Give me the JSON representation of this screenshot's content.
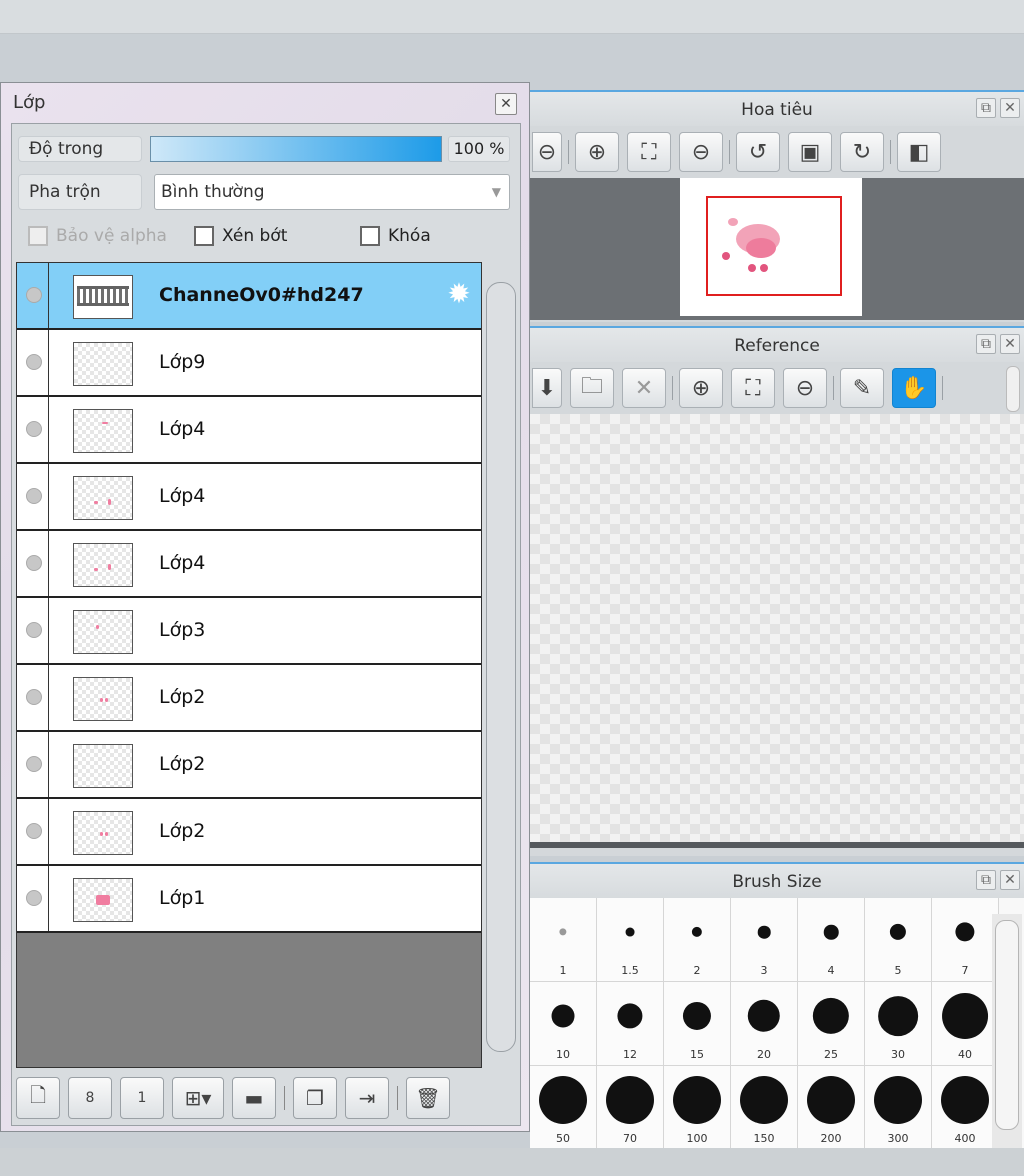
{
  "navigator": {
    "title": "Hoa tiêu",
    "tools": [
      "zoom-actual-icon",
      "zoom-in-icon",
      "fit-icon",
      "zoom-out-icon",
      "rotate-left-icon",
      "frame-icon",
      "rotate-right-icon",
      "flip-icon"
    ],
    "view_rect_color": "#e01f1f"
  },
  "reference": {
    "title": "Reference",
    "tools": [
      "import-icon",
      "open-folder-icon",
      "close-icon",
      "zoom-in-icon",
      "fit-icon",
      "zoom-out-icon",
      "eyedropper-icon",
      "hand-icon"
    ],
    "active_tool": "hand-icon"
  },
  "brush_size": {
    "title": "Brush Size",
    "sizes": [
      "1",
      "1.5",
      "2",
      "3",
      "4",
      "5",
      "7",
      "10",
      "12",
      "15",
      "20",
      "25",
      "30",
      "40",
      "50",
      "70",
      "100",
      "150",
      "200",
      "300",
      "400"
    ]
  },
  "layer_panel": {
    "title": "Lớp",
    "opacity_label": "Độ trong",
    "opacity_value": "100 %",
    "opacity_fraction": 1.0,
    "blend_label": "Pha trộn",
    "blend_value": "Bình thường",
    "protect_alpha_label": "Bảo vệ alpha",
    "clipping_label": "Xén bớt",
    "lock_label": "Khóa",
    "layers": [
      {
        "name": "ChanneOv0#hd247",
        "selected": true
      },
      {
        "name": "Lớp9"
      },
      {
        "name": "Lớp4"
      },
      {
        "name": "Lớp4"
      },
      {
        "name": "Lớp4"
      },
      {
        "name": "Lớp3"
      },
      {
        "name": "Lớp2"
      },
      {
        "name": "Lớp2"
      },
      {
        "name": "Lớp2"
      },
      {
        "name": "Lớp1"
      }
    ],
    "bottom_tools": [
      "new-layer-icon",
      "new-8bit-layer-icon",
      "new-1bit-layer-icon",
      "add-layer-menu-icon",
      "new-folder-icon",
      "duplicate-layer-icon",
      "merge-down-icon",
      "delete-layer-icon"
    ],
    "selection_color": "#82cff7"
  }
}
